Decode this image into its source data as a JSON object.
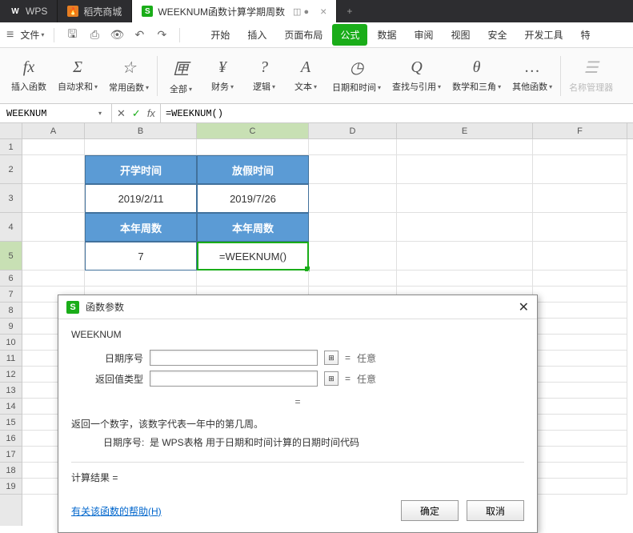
{
  "titlebar": {
    "tabs": [
      {
        "icon": "W",
        "label": "WPS"
      },
      {
        "icon": "🔥",
        "label": "稻壳商城"
      },
      {
        "icon": "S",
        "label": "WEEKNUM函数计算学期周数",
        "extra_icons": "◫ ●"
      }
    ]
  },
  "menubar": {
    "file": "文件",
    "tabs": [
      "开始",
      "插入",
      "页面布局",
      "公式",
      "数据",
      "审阅",
      "视图",
      "安全",
      "开发工具",
      "特"
    ]
  },
  "ribbon": {
    "items": [
      {
        "icon": "fx",
        "label": "插入函数"
      },
      {
        "icon": "Σ",
        "label": "自动求和"
      },
      {
        "icon": "☆",
        "label": "常用函数"
      },
      {
        "icon": "匣",
        "label": "全部"
      },
      {
        "icon": "¥",
        "label": "财务"
      },
      {
        "icon": "?",
        "label": "逻辑"
      },
      {
        "icon": "A",
        "label": "文本"
      },
      {
        "icon": "◷",
        "label": "日期和时间"
      },
      {
        "icon": "Q",
        "label": "查找与引用"
      },
      {
        "icon": "θ",
        "label": "数学和三角"
      },
      {
        "icon": "…",
        "label": "其他函数"
      },
      {
        "icon": "☰",
        "label": "名称管理器"
      }
    ]
  },
  "formula_bar": {
    "name_box": "WEEKNUM",
    "formula": "=WEEKNUM()"
  },
  "columns": [
    "A",
    "B",
    "C",
    "D",
    "E",
    "F"
  ],
  "rows": [
    "1",
    "2",
    "3",
    "4",
    "5",
    "6",
    "7",
    "8",
    "9",
    "10",
    "11",
    "12",
    "13",
    "14",
    "15",
    "16",
    "17",
    "18",
    "19"
  ],
  "table": {
    "h1": "开学时间",
    "h2": "放假时间",
    "d1": "2019/2/11",
    "d2": "2019/7/26",
    "h3": "本年周数",
    "h4": "本年周数",
    "d3": "7",
    "d4": "=WEEKNUM()"
  },
  "dialog": {
    "title": "函数参数",
    "func": "WEEKNUM",
    "param1_label": "日期序号",
    "param2_label": "返回值类型",
    "any": "任意",
    "desc": "返回一个数字，该数字代表一年中的第几周。",
    "param_desc_label": "日期序号:",
    "param_desc": "是 WPS表格 用于日期和时间计算的日期时间代码",
    "result_label": "计算结果 =",
    "help": "有关该函数的帮助(H)",
    "ok": "确定",
    "cancel": "取消"
  }
}
